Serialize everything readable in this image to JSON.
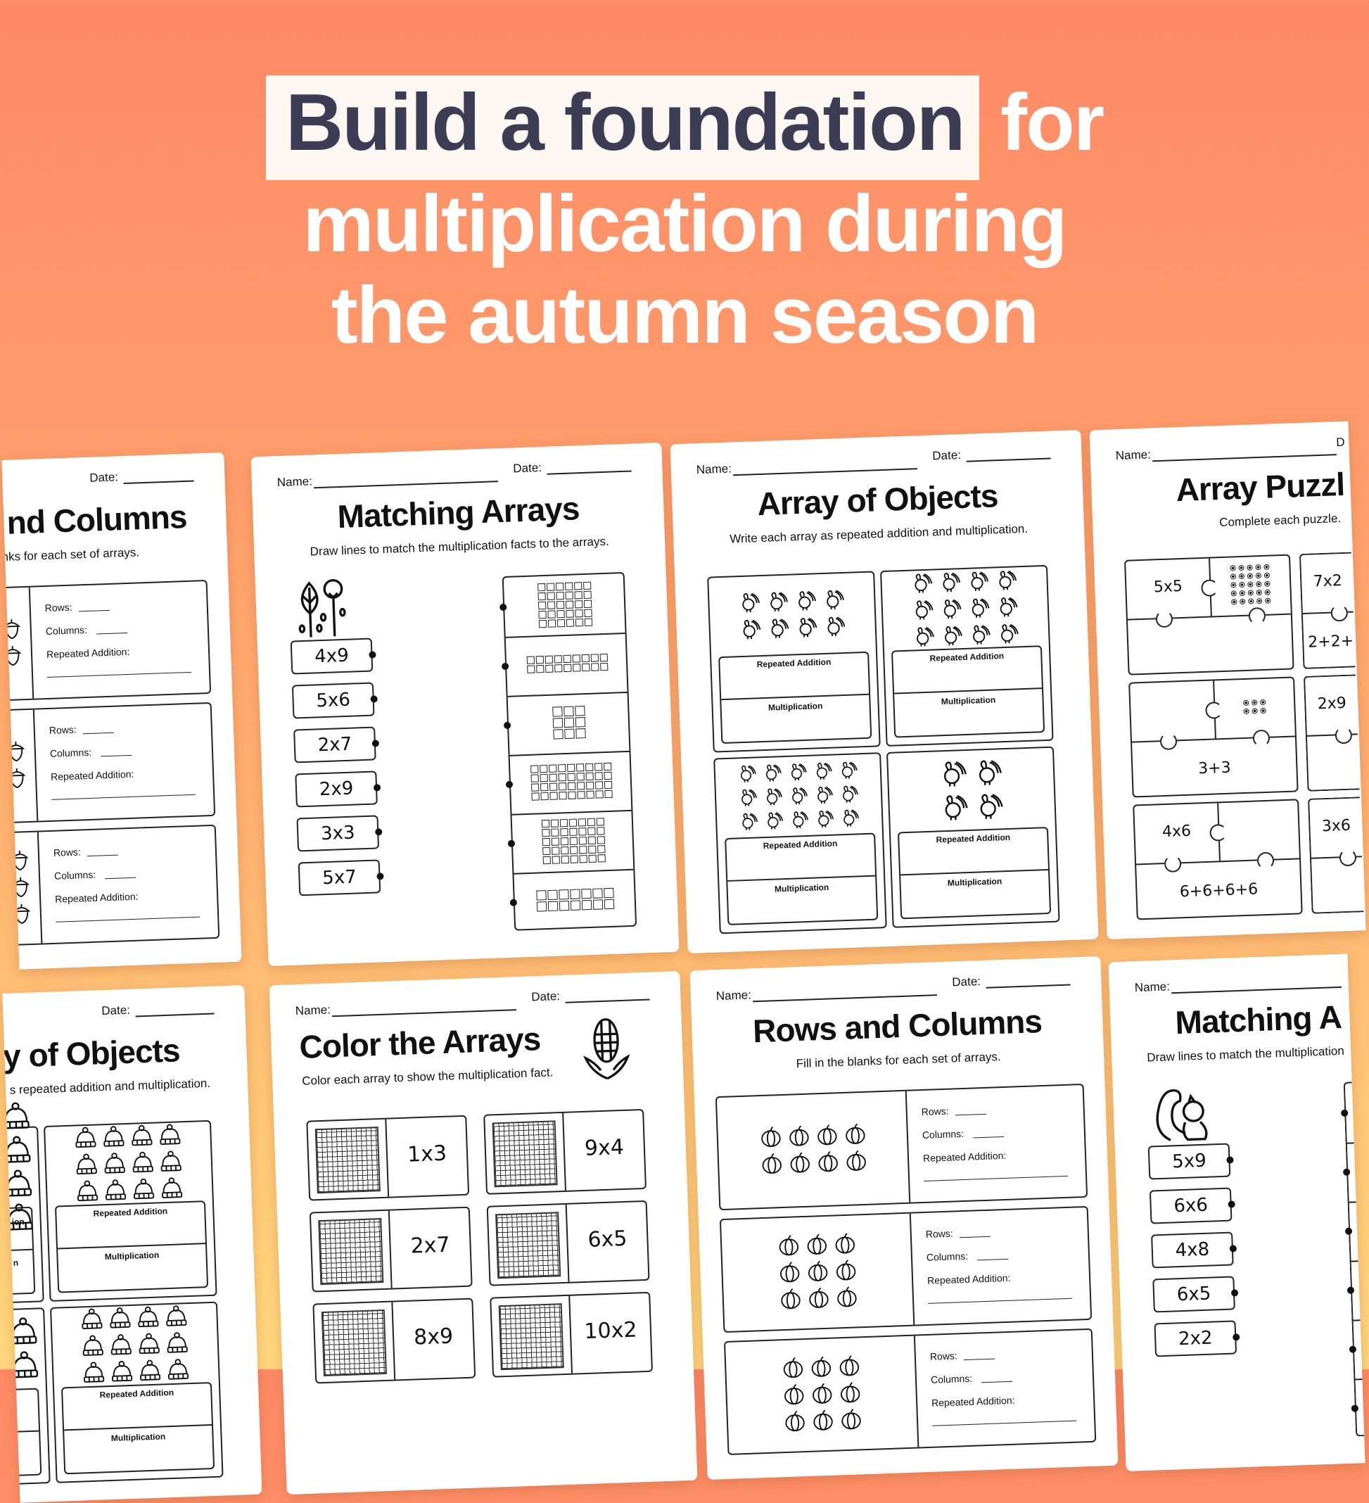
{
  "headline": {
    "highlight": "Build a foundation",
    "line1_rest": "for",
    "line2": "multiplication during",
    "line3": "the autumn season"
  },
  "colors": {
    "bg_top": "#FE8A66",
    "bg_bottom": "#FFD87E",
    "highlight_bg": "#FFF7F2",
    "highlight_text": "#3B3D55",
    "headline_text": "#FFFFFF",
    "ink": "#111111"
  },
  "worksheets": [
    {
      "type": "rows_columns",
      "icon": "acorn-icon",
      "date_label": "Date:",
      "title": "nd Columns",
      "subtitle": "anks for each set of arrays.",
      "fields": {
        "rows": "Rows:",
        "columns": "Columns:",
        "repeated": "Repeated Addition:"
      },
      "sets": [
        {
          "cols": 2,
          "rows": 2
        },
        {
          "cols": 2,
          "rows": 2
        },
        {
          "cols": 2,
          "rows": 3
        }
      ]
    },
    {
      "type": "matching",
      "icon": "trees-icon",
      "name_label": "Name:",
      "date_label": "Date:",
      "title": "Matching Arrays",
      "subtitle": "Draw lines to match the multiplication facts to the arrays.",
      "facts": [
        "4x9",
        "5x6",
        "2x7",
        "2x9",
        "3x3",
        "5x7"
      ],
      "arrays": [
        {
          "cols": 6,
          "rows": 5
        },
        {
          "cols": 9,
          "rows": 2
        },
        {
          "cols": 3,
          "rows": 3
        },
        {
          "cols": 9,
          "rows": 4
        },
        {
          "cols": 7,
          "rows": 5
        },
        {
          "cols": 7,
          "rows": 2
        }
      ]
    },
    {
      "type": "array_objects",
      "icon": "turkey-icon",
      "name_label": "Name:",
      "date_label": "Date:",
      "title": "Array of Objects",
      "subtitle": "Write each array as repeated addition and multiplication.",
      "labels": {
        "repeated": "Repeated Addition",
        "multiplication": "Multiplication"
      },
      "sets": [
        {
          "cols": 4,
          "rows": 2
        },
        {
          "cols": 4,
          "rows": 3
        },
        {
          "cols": 5,
          "rows": 3
        },
        {
          "cols": 2,
          "rows": 2
        }
      ]
    },
    {
      "type": "puzzle",
      "name_label": "Name:",
      "date_label": "D",
      "title": "Array Puzzl",
      "subtitle": "Complete each puzzle.",
      "pieces": [
        {
          "fact": "5x5",
          "dots": {
            "cols": 5,
            "rows": 5
          },
          "addition": ""
        },
        {
          "fact": "7x2",
          "dots": null,
          "addition": "2+2+"
        },
        {
          "fact": "",
          "dots": {
            "cols": 3,
            "rows": 2
          },
          "addition": "3+3"
        },
        {
          "fact": "2x9",
          "dots": null,
          "addition": ""
        },
        {
          "fact": "4x6",
          "dots": null,
          "addition": "6+6+6+6"
        },
        {
          "fact": "3x6",
          "dots": null,
          "addition": ""
        }
      ]
    },
    {
      "type": "array_objects",
      "icon": "beanie-hat-icon",
      "date_label": "Date:",
      "title": "y of Objects",
      "subtitle": "s repeated addition and multiplication.",
      "labels": {
        "repeated": "Repeated Addition",
        "multiplication": "Multiplication"
      },
      "left_labels": {
        "repeated": "ion",
        "multiplication": "n"
      },
      "sets": [
        {
          "cols": 1,
          "rows": 4
        },
        {
          "cols": 4,
          "rows": 3
        },
        {
          "cols": 1,
          "rows": 2
        },
        {
          "cols": 4,
          "rows": 3
        }
      ]
    },
    {
      "type": "color_arrays",
      "icon": "corn-icon",
      "name_label": "Name:",
      "date_label": "Date:",
      "title": "Color the Arrays",
      "subtitle": "Color each array to show the multiplication fact.",
      "facts": [
        "1x3",
        "9x4",
        "2x7",
        "6x5",
        "8x9",
        "10x2"
      ]
    },
    {
      "type": "rows_columns",
      "icon": "pumpkin-icon",
      "name_label": "Name:",
      "date_label": "Date:",
      "title": "Rows and Columns",
      "subtitle": "Fill in the blanks for each set of arrays.",
      "fields": {
        "rows": "Rows:",
        "columns": "Columns:",
        "repeated": "Repeated Addition:"
      },
      "sets": [
        {
          "cols": 4,
          "rows": 2
        },
        {
          "cols": 3,
          "rows": 3
        },
        {
          "cols": 3,
          "rows": 3
        }
      ]
    },
    {
      "type": "matching",
      "icon": "squirrel-icon",
      "name_label": "Name:",
      "title": "Matching A",
      "subtitle": "Draw lines to match the multiplication",
      "facts": [
        "5x9",
        "6x6",
        "4x8",
        "6x5",
        "2x2"
      ],
      "arrays": []
    }
  ]
}
